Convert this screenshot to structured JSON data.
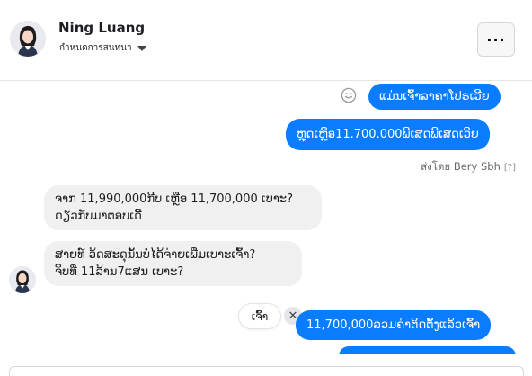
{
  "contact": {
    "name": "Ning Luang",
    "subtitle": "กำหนดการสนทนา"
  },
  "header": {
    "more_label": "..."
  },
  "messages": {
    "out_1": "ແມ່ນເຈົ້າລາຄາໂປຣເວີຍ",
    "out_2": "ຫຼຸດເຫຼືອ11.700.000ພີເສດພີເສດເວີຍ",
    "sent_by": "ส่งโดย Bery Sbh",
    "sent_by_help": "[?]",
    "in_1_line1": "ຈາກ 11,990,000ກີບ ເຫຼືອ 11,700,000 ເບາະ?",
    "in_1_line2": "ດຽວກັບມາຕອບເດີ້",
    "in_2_line1": "ສາຍທ໌ ວ້ດສະດຸນັ້ນບໍ່ໄດ້ຈ່າຍເພີ່ມເບາະເຈົ້າ?",
    "in_2_line2": "ຈິບທີ່ 11ລ້ານ7ແສນ ເບາະ?",
    "reaction_text": "ເຈົ້າ",
    "out_3": "11,700,000ລວມຄ່າຕິດຕັ້ງແລ້ວເຈົ້າ"
  },
  "colors": {
    "outgoing": "#0a7cff",
    "incoming": "#f1f0f0"
  },
  "icons": {
    "smile": "smile-icon",
    "close": "close-icon",
    "more": "more-icon"
  }
}
